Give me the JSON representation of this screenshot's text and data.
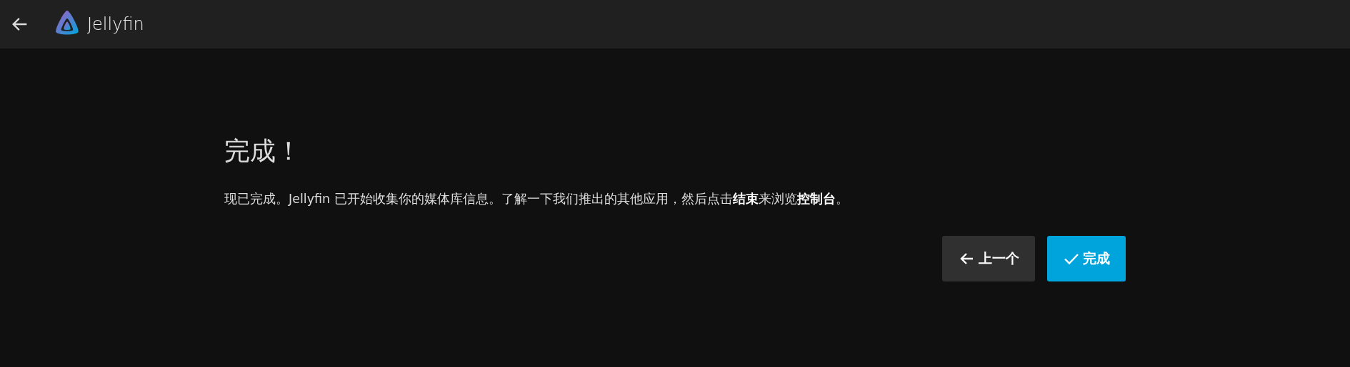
{
  "header": {
    "title": "Jellyfin"
  },
  "heading": "完成！",
  "message": "现已完成。Jellyfin 已开始收集你的媒体库信息。了解一下我们推出的其他应用，然后点击**结束**来浏览**控制台**。",
  "buttons": [
    {
      "label": "上一个",
      "kind": "back"
    },
    {
      "label": "完成",
      "kind": "finish"
    }
  ]
}
